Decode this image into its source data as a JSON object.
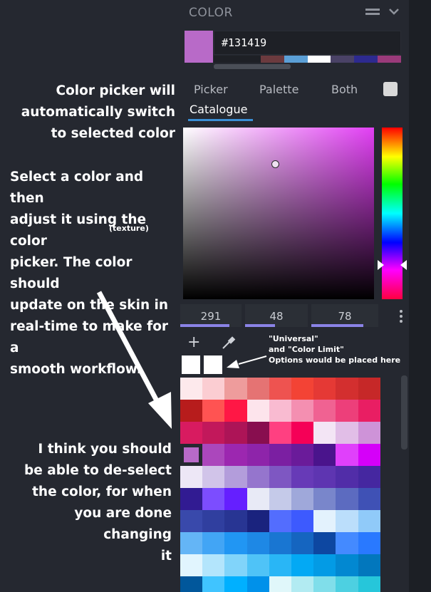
{
  "annotations": {
    "switch_note": [
      "Color picker will",
      "automatically switch",
      "to selected color"
    ],
    "select_note": [
      "Select a color and then",
      "adjust it using the color",
      "picker. The color should",
      "update on the skin in",
      "real-time to make for a",
      "smooth workflow."
    ],
    "texture_note": "(texture)",
    "universal_note": [
      "\"Universal\"",
      "and \"Color Limit\"",
      "Options would be placed here"
    ],
    "deselect_note": [
      "I think you should",
      "be able to de-select",
      "the color, for when",
      "you are done changing",
      "it"
    ]
  },
  "panel": {
    "title": "COLOR",
    "hex_value": "#131419",
    "current_color": "#b86ac8",
    "history_colors": [
      "#1e2026",
      "#1e2026",
      "#6b3a3e",
      "#5b9fd6",
      "#ffffff",
      "#4a4266",
      "#2d2a8f",
      "#9a3a7a"
    ],
    "tabs": [
      "Picker",
      "Palette",
      "Both",
      "Catalogue"
    ],
    "active_tab": "Catalogue",
    "hsv": {
      "h": "291",
      "s": "48",
      "v": "78"
    },
    "sv_hue_color": "#e23ff4",
    "icons": [
      "menu-icon",
      "chevron-down-icon",
      "plus-icon",
      "eyedropper-icon",
      "kebab-icon"
    ],
    "palette_rows": [
      [
        "#fde9ec",
        "#fbcdd2",
        "#ee9c9c",
        "#e57373",
        "#ee5350",
        "#f34335",
        "#e53935",
        "#d32f2f",
        "#c62828"
      ],
      [
        "#b71c1c",
        "#ff5352",
        "#ff1745",
        "#fde4ec",
        "#f9bbd1",
        "#f48fb1",
        "#f06292",
        "#ed3f7a",
        "#e91e63"
      ],
      [
        "#d81b60",
        "#c2185b",
        "#ad1457",
        "#880e4f",
        "#ff4081",
        "#f50057",
        "#f3e5f5",
        "#e1bee7",
        "#ce93d8"
      ],
      [
        "#252830",
        "#ab47bc",
        "#9c27b0",
        "#8e24aa",
        "#7b1fa2",
        "#6a1b9a",
        "#4a148c",
        "#e040fb",
        "#d500f9"
      ],
      [
        "#ede7f6",
        "#d1c4e9",
        "#b39ddb",
        "#9575cd",
        "#7e57c2",
        "#673ab7",
        "#5e35b1",
        "#512da8",
        "#4527a0"
      ],
      [
        "#311b92",
        "#7c4dff",
        "#651fff",
        "#e8eaf6",
        "#c5cae9",
        "#9fa8da",
        "#7986cb",
        "#5c6bc0",
        "#3f51b5"
      ],
      [
        "#3949ab",
        "#303f9f",
        "#283593",
        "#1a237e",
        "#536dfe",
        "#3d5afe",
        "#e3f2fd",
        "#bbdefb",
        "#90caf9"
      ],
      [
        "#64b5f6",
        "#42a5f5",
        "#2196f3",
        "#1e88e5",
        "#1976d2",
        "#1565c0",
        "#0d47a1",
        "#448aff",
        "#2979ff"
      ],
      [
        "#e1f5fe",
        "#b3e5fc",
        "#81d4fa",
        "#4fc3f7",
        "#29b6f6",
        "#03a9f4",
        "#039be5",
        "#0288d1",
        "#0277bd"
      ],
      [
        "#01579b",
        "#40c4ff",
        "#00b0ff",
        "#0091ea",
        "#e0f7fa",
        "#b2ebf2",
        "#80deea",
        "#4dd0e1",
        "#26c6da"
      ]
    ],
    "selected_cell_color": "#b86ac8"
  }
}
